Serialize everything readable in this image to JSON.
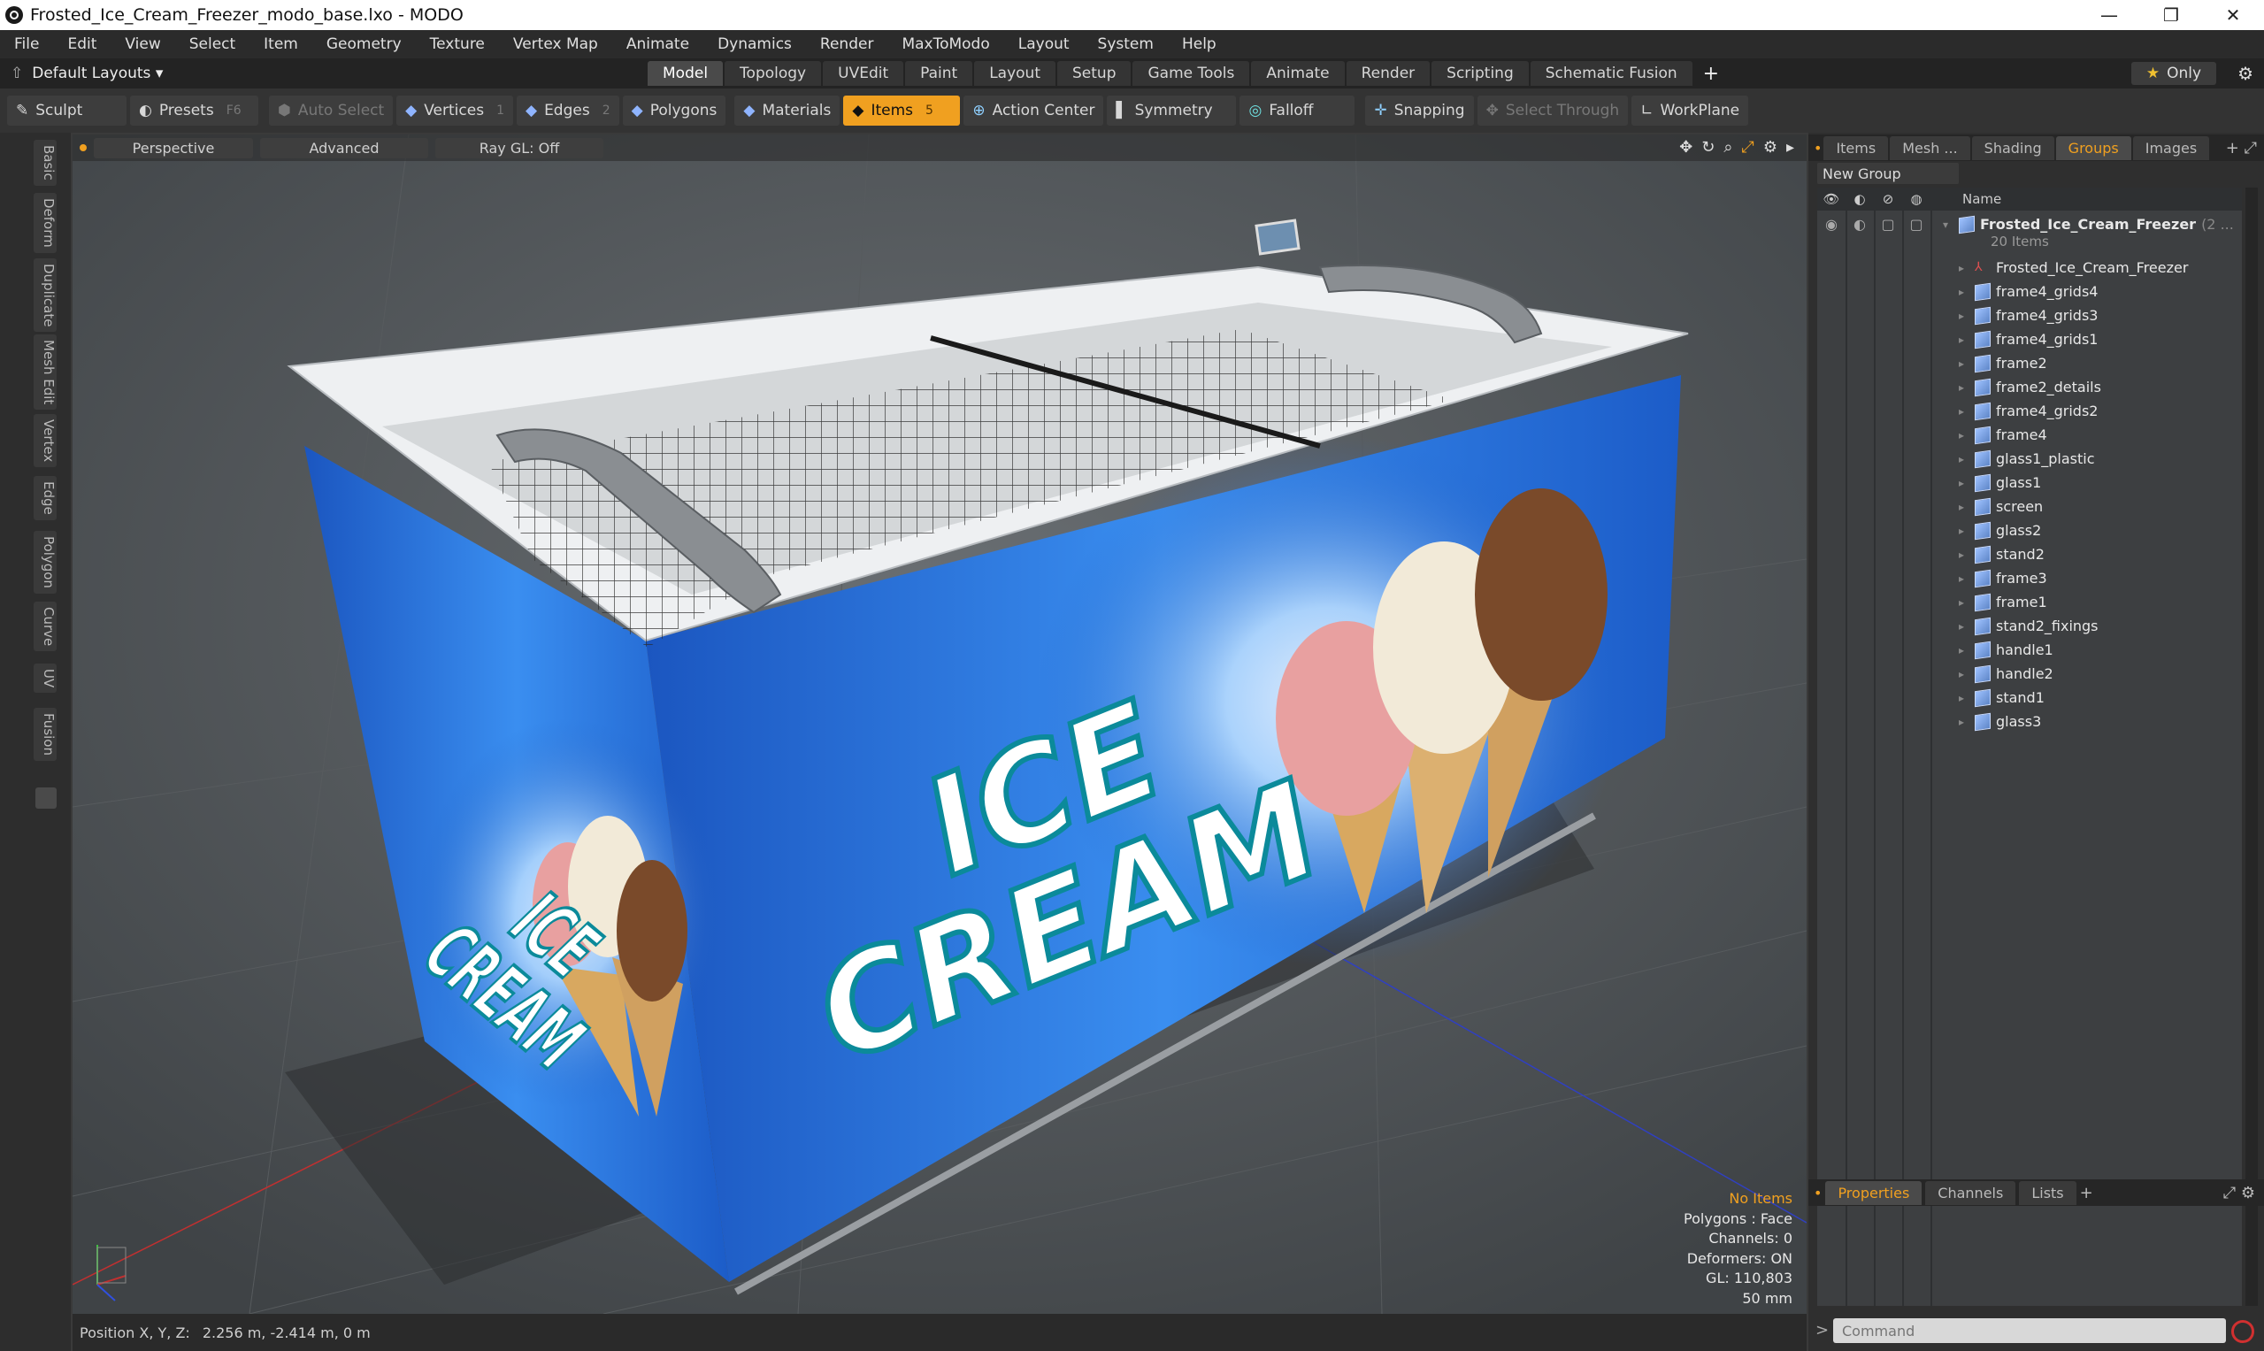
{
  "window": {
    "title": "Frosted_Ice_Cream_Freezer_modo_base.lxo - MODO",
    "min_label": "—",
    "max_label": "❐",
    "close_label": "✕"
  },
  "menu": [
    "File",
    "Edit",
    "View",
    "Select",
    "Item",
    "Geometry",
    "Texture",
    "Vertex Map",
    "Animate",
    "Dynamics",
    "Render",
    "MaxToModo",
    "Layout",
    "System",
    "Help"
  ],
  "layout_bar": {
    "layout_label": "Default Layouts ▾",
    "tabs": [
      "Model",
      "Topology",
      "UVEdit",
      "Paint",
      "Layout",
      "Setup",
      "Game Tools",
      "Animate",
      "Render",
      "Scripting",
      "Schematic Fusion"
    ],
    "active_tab": "Model",
    "plus": "+",
    "only_label": "Only",
    "star": "★"
  },
  "toolbar": {
    "sculpt": "Sculpt",
    "presets": "Presets",
    "presets_key": "F6",
    "auto_select": "Auto Select",
    "vertices": "Vertices",
    "vertices_num": "1",
    "edges": "Edges",
    "edges_num": "2",
    "polygons": "Polygons",
    "materials": "Materials",
    "items": "Items",
    "items_num": "5",
    "action_center": "Action Center",
    "symmetry": "Symmetry",
    "falloff": "Falloff",
    "snapping": "Snapping",
    "select_through": "Select Through",
    "workplane": "WorkPlane"
  },
  "left_tabs": [
    "Basic",
    "Deform",
    "Duplicate",
    "Mesh Edit",
    "Vertex",
    "Edge",
    "Polygon",
    "Curve",
    "UV",
    "Fusion"
  ],
  "viewport": {
    "perspective": "Perspective",
    "advanced": "Advanced",
    "raygl": "Ray GL: Off",
    "info": {
      "no_items": "No Items",
      "polygons": "Polygons : Face",
      "channels": "Channels: 0",
      "deformers": "Deformers: ON",
      "gl": "GL: 110,803",
      "scale": "50 mm"
    },
    "decal_line1": "ICE",
    "decal_line2": "CREAM"
  },
  "status": {
    "position_label": "Position X, Y, Z:",
    "position_value": "2.256 m, -2.414 m, 0 m"
  },
  "right_panel": {
    "tabs": [
      "Items",
      "Mesh ...",
      "Shading",
      "Groups",
      "Images"
    ],
    "active_tab": "Groups",
    "new_group": "New Group",
    "name_header": "Name",
    "group_name": "Frosted_Ice_Cream_Freezer",
    "group_suffix": "(2 ...",
    "group_count": "20 Items",
    "items": [
      "Frosted_Ice_Cream_Freezer",
      "frame4_grids4",
      "frame4_grids3",
      "frame4_grids1",
      "frame2",
      "frame2_details",
      "frame4_grids2",
      "frame4",
      "glass1_plastic",
      "glass1",
      "screen",
      "glass2",
      "stand2",
      "frame3",
      "frame1",
      "stand2_fixings",
      "handle1",
      "handle2",
      "stand1",
      "glass3"
    ],
    "props_tabs": [
      "Properties",
      "Channels",
      "Lists"
    ],
    "props_active": "Properties",
    "command_placeholder": "Command"
  },
  "colors": {
    "accent": "#f0a020",
    "viewport": "#5a5f63",
    "panel": "#2f2f2f",
    "decal_blue": "#1e5fc4"
  }
}
